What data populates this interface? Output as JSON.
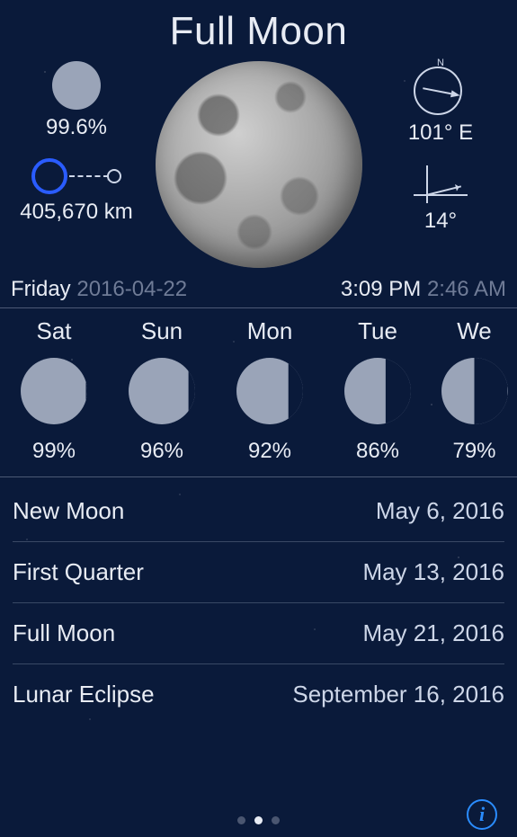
{
  "title": "Full Moon",
  "illumination": {
    "value": "99.6%"
  },
  "distance": {
    "value": "405,670 km"
  },
  "azimuth": {
    "value": "101° E",
    "degrees": 101,
    "n_label": "N"
  },
  "altitude": {
    "value": "14°",
    "degrees": 14
  },
  "timebar": {
    "day_name": "Friday",
    "date": "2016-04-22",
    "time": "3:09 PM",
    "rise_time": "2:46 AM"
  },
  "forecast": [
    {
      "label": "Sat",
      "percent": "99%",
      "shadow_left_pct": 98
    },
    {
      "label": "Sun",
      "percent": "96%",
      "shadow_left_pct": 90
    },
    {
      "label": "Mon",
      "percent": "92%",
      "shadow_left_pct": 78
    },
    {
      "label": "Tue",
      "percent": "86%",
      "shadow_left_pct": 62
    },
    {
      "label": "We",
      "percent": "79%",
      "shadow_left_pct": 50
    }
  ],
  "events": [
    {
      "name": "New Moon",
      "date": "May 6, 2016"
    },
    {
      "name": "First Quarter",
      "date": "May 13, 2016"
    },
    {
      "name": "Full Moon",
      "date": "May 21, 2016"
    },
    {
      "name": "Lunar Eclipse",
      "date": "September 16, 2016"
    }
  ],
  "pager": {
    "count": 3,
    "active_index": 1
  },
  "info_button": {
    "label": "i"
  }
}
